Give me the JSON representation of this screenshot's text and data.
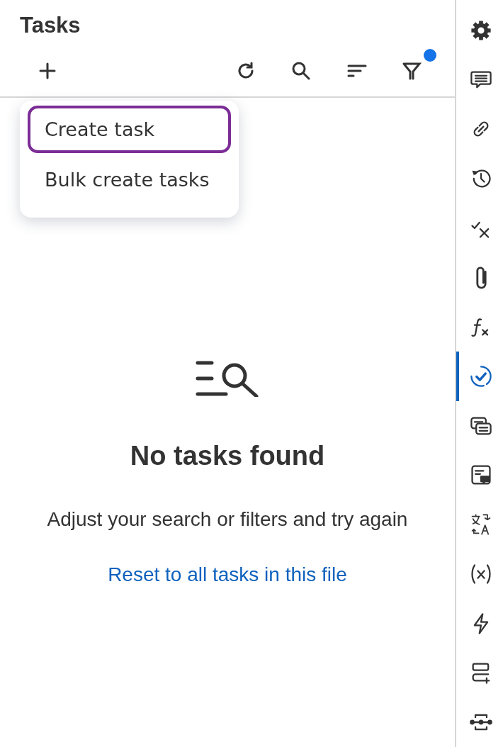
{
  "panel": {
    "title": "Tasks"
  },
  "toolbar": {
    "filter_active": true
  },
  "add_menu": {
    "items": [
      {
        "label": "Create task",
        "selected": true
      },
      {
        "label": "Bulk create tasks",
        "selected": false
      }
    ]
  },
  "empty_state": {
    "title": "No tasks found",
    "message": "Adjust your search or filters and try again",
    "link": "Reset to all tasks in this file"
  },
  "rail": {
    "items": [
      {
        "selected": false
      },
      {
        "selected": false
      },
      {
        "selected": false
      },
      {
        "selected": false
      },
      {
        "selected": false
      },
      {
        "selected": false
      },
      {
        "selected": false
      },
      {
        "selected": true
      },
      {
        "selected": false
      },
      {
        "selected": false
      },
      {
        "selected": false
      },
      {
        "selected": false
      },
      {
        "selected": false
      },
      {
        "selected": false
      },
      {
        "selected": false
      }
    ]
  }
}
